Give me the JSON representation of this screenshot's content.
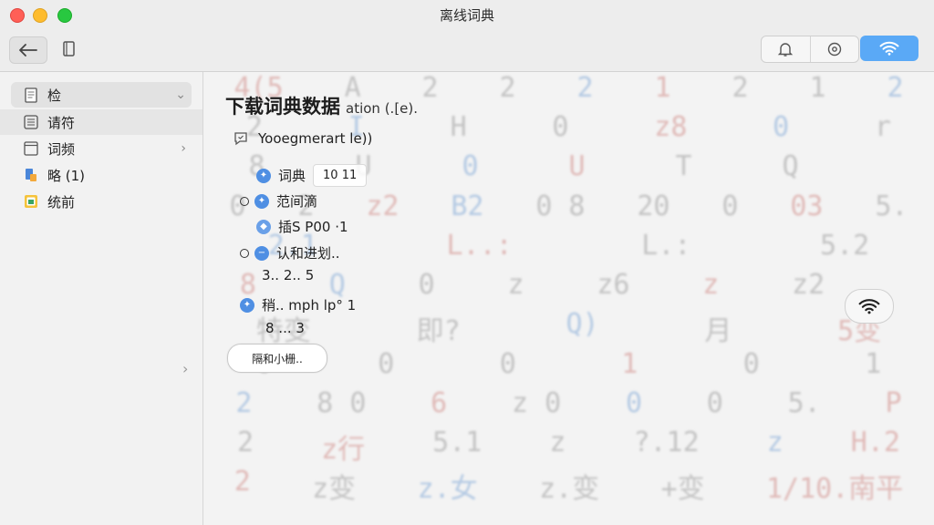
{
  "window": {
    "title": "离线词典"
  },
  "toolbar": {
    "back_icon": "arrow-left-icon",
    "book_icon": "book-icon",
    "group_icons": [
      "bell-icon",
      "gear-icon"
    ],
    "wifi_icon": "wifi-icon",
    "wifi_color": "#5aa9f6"
  },
  "sidebar": {
    "items": [
      {
        "label": "检",
        "icon": "document-icon",
        "selected": true
      },
      {
        "label": "请符",
        "icon": "list-icon",
        "selected": false
      },
      {
        "label": "词频",
        "icon": "window-icon",
        "selected": false
      },
      {
        "label": "略 (1)",
        "icon": "tag-icon",
        "selected": false
      },
      {
        "label": "统前",
        "icon": "grid-icon",
        "selected": false
      }
    ]
  },
  "main": {
    "title": "下载词典数据",
    "title_suffix": "ation (.[e).",
    "intro": "Yooegmerart le))",
    "rows": [
      {
        "label": "词典",
        "tag": "10 11"
      },
      {
        "label": "范间滴"
      },
      {
        "label": "插S P00 ·1"
      },
      {
        "label": "认和进划.."
      },
      {
        "label": "3.. 2.. 5"
      },
      {
        "label": "稍.. mph lp° 1"
      },
      {
        "label": "8 ... 3"
      }
    ],
    "button_label": "隔和小栅.."
  },
  "background_rows": [
    [
      "4(5",
      "A",
      "2",
      "2",
      "2",
      "1",
      "2",
      "1",
      "2"
    ],
    [
      "2",
      "I",
      "H",
      "0",
      "z8",
      "0",
      "r"
    ],
    [
      "8",
      "U",
      "0",
      "U",
      "T",
      "Q",
      ""
    ],
    [
      "0",
      "2",
      "z2",
      "B2",
      "0 8",
      "20",
      "0",
      "03",
      "5."
    ],
    [
      "2.1",
      "L..:",
      "L.:",
      "5.2"
    ],
    [
      "8",
      "Q",
      "0",
      "z",
      "z6",
      "z",
      "z2",
      ""
    ],
    [
      "特变",
      "即?",
      "Q)",
      "月",
      "5变"
    ],
    [
      "0",
      "0",
      "0",
      "1",
      "0",
      "1"
    ],
    [
      "2",
      "8 0",
      "6",
      "z 0",
      "0",
      "0",
      "5.",
      "P"
    ],
    [
      "2",
      "z行",
      "5.1",
      "z",
      "?.12",
      "z",
      "H.2"
    ],
    [
      "2",
      "z变",
      "z.女",
      "z.变",
      "+变",
      "1/10.南平"
    ]
  ]
}
